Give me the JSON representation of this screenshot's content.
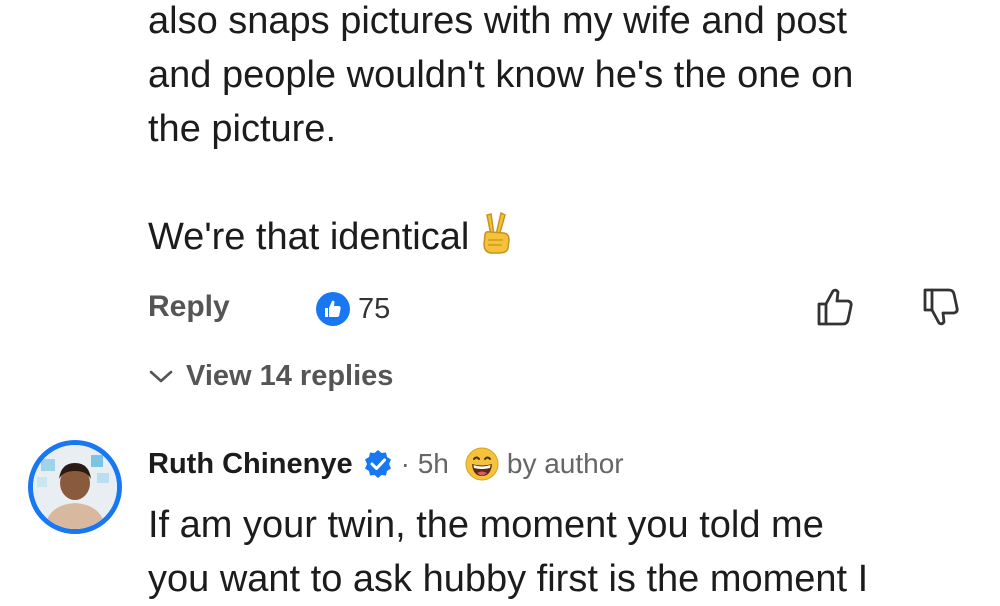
{
  "comment": {
    "lines": [
      "also snaps pictures with my wife and post",
      "and people wouldn't know he's the one on",
      "the picture."
    ],
    "last_line": "We're that identical",
    "emoji": "victory-hand-emoji"
  },
  "actions": {
    "reply_label": "Reply",
    "like_count": "75",
    "like_icon": "thumbs-up-icon",
    "thumb_up_icon": "thumb-up-outline-icon",
    "thumb_down_icon": "thumb-down-outline-icon"
  },
  "replies_toggle": {
    "label": "View 14 replies",
    "icon": "chevron-down-icon"
  },
  "reply": {
    "author": "Ruth Chinenye",
    "verified": true,
    "time": "· 5h",
    "badge_emoji": "grinning-face-emoji",
    "badge_text": "by author",
    "lines": [
      "If am your twin, the moment you told me",
      "you want to ask hubby first is the moment I"
    ]
  },
  "colors": {
    "accent": "#1877f2",
    "text": "#1c1c1c",
    "muted": "#555555",
    "emoji_yellow": "#f5c33b"
  }
}
